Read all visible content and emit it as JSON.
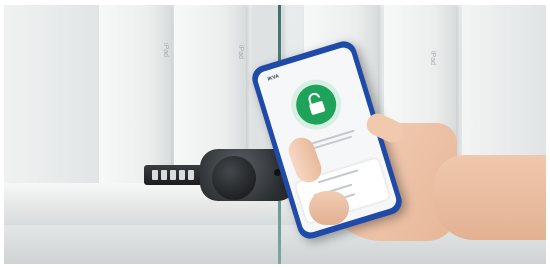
{
  "photo": {
    "description_colors": {
      "background": "#e6e9e9",
      "lock": "#2a2d30",
      "phone_frame": "#1f4aa8",
      "unlock_green": "#1fa35a",
      "skin": "#f0c8ad"
    },
    "box_labels": [
      "iPad",
      "iPad",
      "iPad"
    ],
    "app": {
      "title": "IKVA",
      "icon": "unlock-icon"
    }
  }
}
